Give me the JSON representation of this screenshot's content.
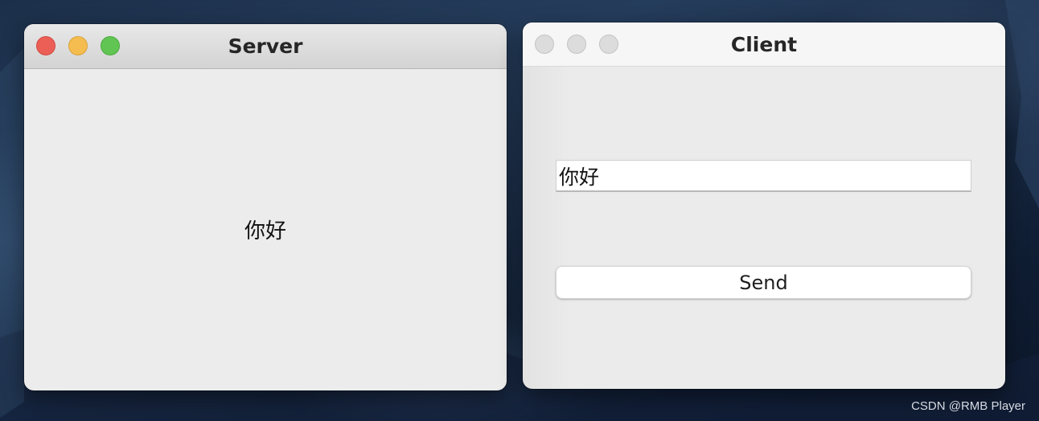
{
  "server_window": {
    "title": "Server",
    "message": "你好",
    "window_controls": [
      "close",
      "minimize",
      "zoom"
    ],
    "colors": {
      "close": "#ec5f57",
      "minimize": "#f5bd4f",
      "zoom": "#61c554"
    }
  },
  "client_window": {
    "title": "Client",
    "input_value": "你好",
    "send_label": "Send",
    "window_controls": [
      "close-inactive",
      "minimize-inactive",
      "zoom-inactive"
    ]
  },
  "desktop": {
    "watermark": "CSDN @RMB Player"
  }
}
